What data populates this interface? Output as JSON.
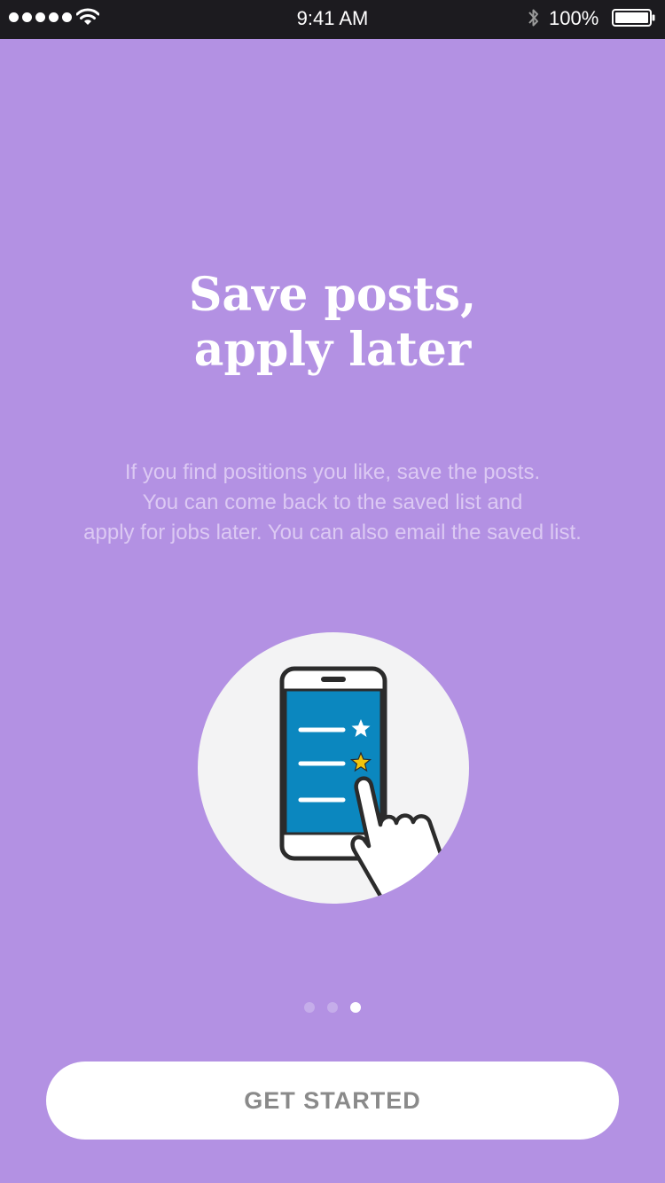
{
  "status_bar": {
    "time": "9:41 AM",
    "battery_percent": "100%",
    "signal_bars": 5,
    "icons": [
      "signal-icon",
      "wifi-icon",
      "bluetooth-icon",
      "battery-icon"
    ]
  },
  "onboarding": {
    "title": "Save posts,\napply later",
    "description": "If you find positions you like, save the posts.\nYou can come back to the saved list and\napply for jobs later. You can also email the saved list.",
    "illustration_icon": "phone-saved-list-tap-icon",
    "page_count": 3,
    "current_page": 3,
    "cta_label": "GET STARTED"
  },
  "colors": {
    "background": "#b391e3",
    "status_bar": "#1c1b1f",
    "phone_screen": "#0b87bf",
    "star_active": "#f2c40c",
    "cta_text": "#8a8a8a",
    "circle_bg": "#f3f3f4"
  }
}
